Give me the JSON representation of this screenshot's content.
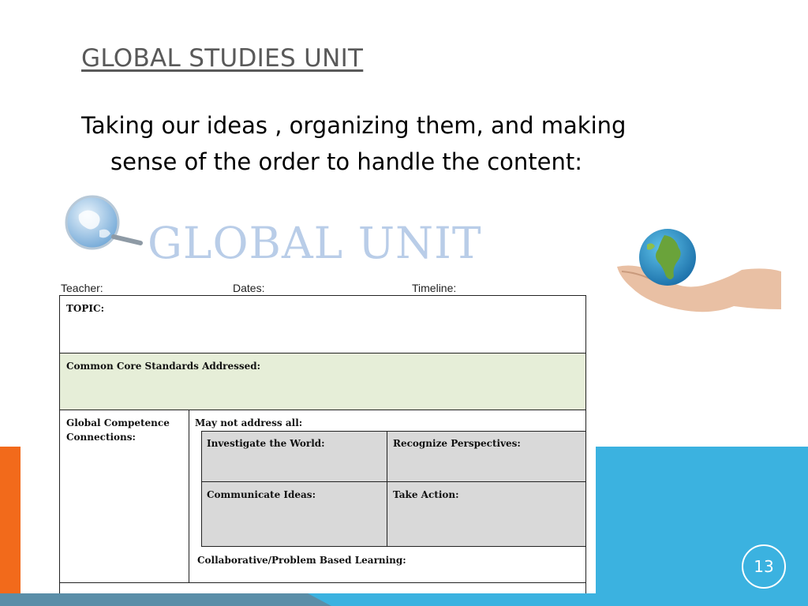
{
  "slide": {
    "title": "GLOBAL STUDIES UNIT",
    "body_line1": "Taking our ideas , organizing them, and making",
    "body_line2": "sense of the order to handle the content:",
    "page_number": "13"
  },
  "form": {
    "banner": "GLOBAL UNIT",
    "header": {
      "teacher": "Teacher:",
      "dates": "Dates:",
      "timeline": "Timeline:"
    },
    "topic": "TOPIC:",
    "standards": "Common Core Standards Addressed:",
    "competence_line1": "Global Competence",
    "competence_line2": "Connections:",
    "may_not": "May not address all:",
    "investigate": "Investigate the World:",
    "recognize": "Recognize Perspectives:",
    "communicate": "Communicate Ideas:",
    "take_action": "Take Action:",
    "collab": "Collaborative/Problem  Based Learning:"
  },
  "colors": {
    "accent_orange": "#f26a1b",
    "accent_blue": "#3bb2e0",
    "standards_fill": "#e6eed8",
    "cell_fill": "#d9d9d9"
  },
  "icons": [
    "globe-magnifier-icon",
    "globe-in-hand-icon"
  ]
}
